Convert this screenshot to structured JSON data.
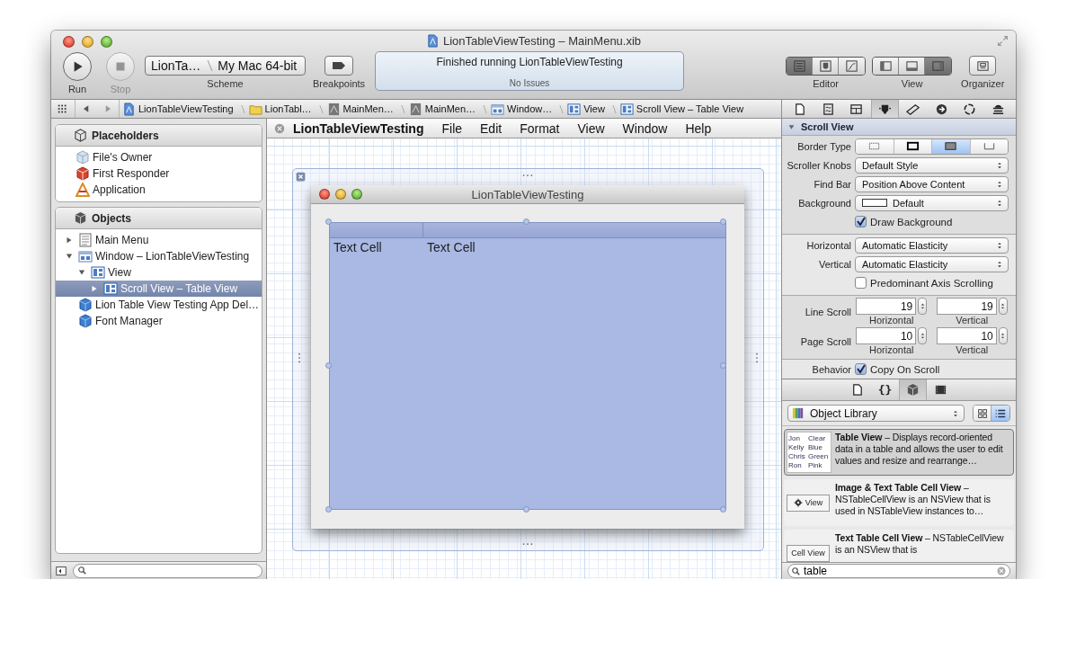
{
  "window": {
    "title": "LionTableViewTesting – MainMenu.xib"
  },
  "toolbar": {
    "run": {
      "label": "Run"
    },
    "stop": {
      "label": "Stop",
      "disabled": true
    },
    "scheme": {
      "target": "LionTa…",
      "destination": "My Mac 64-bit",
      "label": "Scheme"
    },
    "breakpoints": {
      "label": "Breakpoints"
    },
    "activity": {
      "status": "Finished running LionTableViewTesting",
      "issues": "No Issues"
    },
    "editor": {
      "label": "Editor",
      "modes": [
        {
          "kind": "standard",
          "selected": true
        },
        {
          "kind": "assistant",
          "selected": false
        },
        {
          "kind": "version",
          "selected": false
        }
      ]
    },
    "view": {
      "label": "View",
      "panes": [
        {
          "kind": "navigator",
          "on": false
        },
        {
          "kind": "debug",
          "on": false
        },
        {
          "kind": "utilities",
          "on": true
        }
      ]
    },
    "organizer": {
      "label": "Organizer"
    }
  },
  "jump_bar": {
    "items": [
      {
        "kind": "project",
        "label": "LionTableViewTesting"
      },
      {
        "kind": "folder",
        "label": "LionTabl…"
      },
      {
        "kind": "xib",
        "label": "MainMen…"
      },
      {
        "kind": "xib",
        "label": "MainMen…"
      },
      {
        "kind": "window",
        "label": "Window…"
      },
      {
        "kind": "view",
        "label": "View"
      },
      {
        "kind": "view",
        "label": "Scroll View – Table View"
      }
    ]
  },
  "inspector_tabs": [
    {
      "kind": "file",
      "selected": false
    },
    {
      "kind": "help",
      "selected": false
    },
    {
      "kind": "identity",
      "selected": false
    },
    {
      "kind": "attributes",
      "selected": true
    },
    {
      "kind": "size",
      "selected": false
    },
    {
      "kind": "connections",
      "selected": false
    },
    {
      "kind": "bindings",
      "selected": false
    },
    {
      "kind": "effects",
      "selected": false
    }
  ],
  "navigator": {
    "sections": [
      {
        "title": "Placeholders",
        "items": [
          {
            "kind": "owner",
            "label": "File's Owner",
            "selected": false
          },
          {
            "kind": "responder",
            "label": "First Responder",
            "selected": false
          },
          {
            "kind": "application",
            "label": "Application",
            "selected": false
          }
        ]
      },
      {
        "title": "Objects",
        "items": [
          {
            "kind": "menu",
            "label": "Main Menu",
            "expanded": false,
            "selected": false
          },
          {
            "kind": "window",
            "label": "Window – LionTableViewTesting",
            "expanded": true,
            "selected": false,
            "children": [
              {
                "kind": "view",
                "label": "View",
                "expanded": true,
                "selected": false,
                "children": [
                  {
                    "kind": "view",
                    "label": "Scroll View – Table View",
                    "expanded": false,
                    "selected": true
                  }
                ]
              }
            ]
          },
          {
            "kind": "object",
            "label": "Lion Table View Testing App Del…",
            "selected": false
          },
          {
            "kind": "object",
            "label": "Font Manager",
            "selected": false
          }
        ]
      }
    ]
  },
  "canvas": {
    "menu_bar": [
      {
        "kind": "app",
        "label": "LionTableViewTesting"
      },
      {
        "kind": "menu",
        "label": "File"
      },
      {
        "kind": "menu",
        "label": "Edit"
      },
      {
        "kind": "menu",
        "label": "Format"
      },
      {
        "kind": "menu",
        "label": "View"
      },
      {
        "kind": "menu",
        "label": "Window"
      },
      {
        "kind": "menu",
        "label": "Help"
      }
    ],
    "window": {
      "title": "LionTableViewTesting",
      "cells": [
        "Text Cell",
        "Text Cell"
      ]
    }
  },
  "inspector": {
    "title": "Scroll View",
    "groups": [
      {
        "rows": [
          {
            "kind": "segments",
            "label": "Border Type",
            "options": [
              {
                "kind": "none",
                "selected": false
              },
              {
                "kind": "line",
                "selected": false
              },
              {
                "kind": "bezel",
                "selected": true
              },
              {
                "kind": "groove",
                "selected": false
              }
            ]
          },
          {
            "kind": "popup",
            "label": "Scroller Knobs",
            "value": "Default Style"
          },
          {
            "kind": "popup",
            "label": "Find Bar",
            "value": "Position Above Content"
          },
          {
            "kind": "color",
            "label": "Background",
            "value": "Default"
          },
          {
            "kind": "checkbox",
            "option": "Draw Background",
            "checked": true
          }
        ]
      },
      {
        "rows": [
          {
            "kind": "popup",
            "label": "Horizontal",
            "value": "Automatic Elasticity"
          },
          {
            "kind": "popup",
            "label": "Vertical",
            "value": "Automatic Elasticity"
          },
          {
            "kind": "checkbox",
            "option": "Predominant Axis Scrolling",
            "checked": false
          }
        ]
      },
      {
        "rows": [
          {
            "kind": "steppers",
            "label": "Line Scroll",
            "values": [
              "19",
              "19"
            ],
            "sublabels": [
              "Horizontal",
              "Vertical"
            ]
          },
          {
            "kind": "steppers",
            "label": "Page Scroll",
            "values": [
              "10",
              "10"
            ],
            "sublabels": [
              "Horizontal",
              "Vertical"
            ]
          }
        ]
      },
      {
        "rows": [
          {
            "kind": "checkbox",
            "label": "Behavior",
            "option": "Copy On Scroll",
            "checked": true
          }
        ]
      }
    ]
  },
  "library": {
    "tabs": [
      {
        "kind": "file",
        "selected": false
      },
      {
        "kind": "code",
        "glyph": "{}",
        "selected": false
      },
      {
        "kind": "object",
        "selected": true
      },
      {
        "kind": "media",
        "selected": false
      }
    ],
    "picker": "Object Library",
    "view_modes": [
      {
        "kind": "grid",
        "selected": false
      },
      {
        "kind": "list",
        "selected": true
      }
    ],
    "items": [
      {
        "kind": "table",
        "text": "**Table View** – Displays record-oriented data in a table and allows the user to edit values and resize and rearrange…",
        "selected": true,
        "thumb_cells": [
          "Jon",
          "Clear",
          "Kelly",
          "Blue",
          "Chris",
          "Green",
          "Ron",
          "Pink"
        ]
      },
      {
        "kind": "image-cell",
        "text": "**Image & Text Table Cell View** – NSTableCellView is an NSView that is used in NSTableView instances to…",
        "selected": false,
        "thumb": "View"
      },
      {
        "kind": "text-cell",
        "text": "**Text Table Cell View** – NSTableCellView is an NSView that is",
        "selected": false,
        "thumb": "Cell View"
      }
    ],
    "search": {
      "value": "table"
    }
  }
}
